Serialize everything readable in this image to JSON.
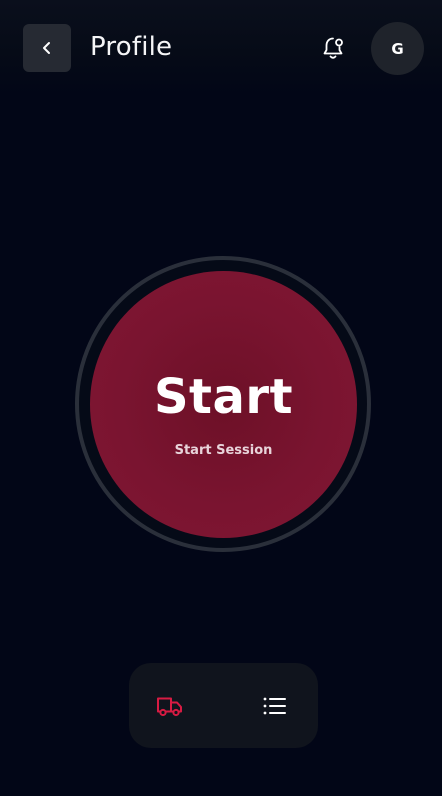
{
  "header": {
    "title": "Profile",
    "avatar_initial": "G",
    "back_icon": "chevron-left-icon",
    "notification_icon": "bell-icon"
  },
  "main": {
    "button_label": "Start",
    "button_sublabel": "Start Session"
  },
  "bottom_nav": {
    "items": [
      {
        "icon": "truck-icon",
        "active": true
      },
      {
        "icon": "list-icon",
        "active": false
      }
    ]
  },
  "colors": {
    "background": "#020617",
    "accent": "#7a1430",
    "active_icon": "#d81b43",
    "inactive_icon": "#ffffff"
  }
}
